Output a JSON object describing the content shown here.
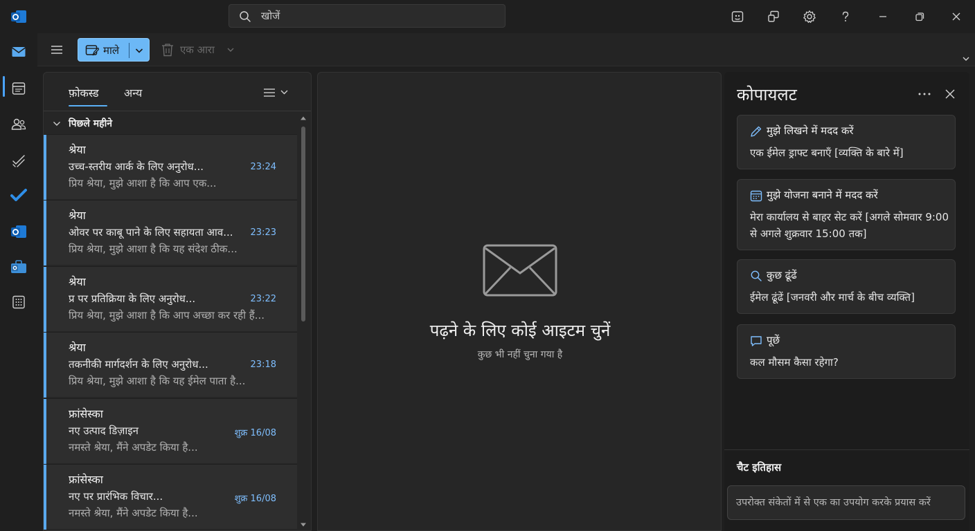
{
  "app": {
    "search_placeholder": "खोजें"
  },
  "toolbar": {
    "new_mail_label": "माले",
    "delete_label": "एक आरा"
  },
  "list": {
    "tabs": [
      {
        "label": "फ़ोकस्ड",
        "active": true
      },
      {
        "label": "अन्य",
        "active": false
      }
    ],
    "group_label": "पिछले महीने",
    "messages": [
      {
        "sender": "श्रेया",
        "subject": "उच्च-स्तरीय आर्क के लिए अनुरोध...",
        "time": "23:24",
        "preview": "प्रिय श्रेया, मुझे आशा है कि आप एक..."
      },
      {
        "sender": "श्रेया",
        "subject": "ओवर पर काबू पाने के लिए सहायता आव...",
        "time": "23:23",
        "preview": "प्रिय श्रेया, मुझे आशा है कि यह संदेश ठीक..."
      },
      {
        "sender": "श्रेया",
        "subject": "प्र पर प्रतिक्रिया के लिए अनुरोध...",
        "time": "23:22",
        "preview": "प्रिय श्रेया, मुझे आशा है कि आप अच्छा कर रही हैं..."
      },
      {
        "sender": "श्रेया",
        "subject": "तकनीकी मार्गदर्शन के लिए अनुरोध...",
        "time": "23:18",
        "preview": "प्रिय श्रेया, मुझे आशा है कि यह ईमेल पाता है..."
      },
      {
        "sender": "फ्रांसेस्का",
        "subject": "नए उत्पाद डिज़ाइन",
        "time": "शुक्र 16/08",
        "preview": "नमस्ते श्रेया, मैंने अपडेट किया है..."
      },
      {
        "sender": "फ्रांसेस्का",
        "subject": "नए पर प्रारंभिक विचार...",
        "time": "शुक्र 16/08",
        "preview": "नमस्ते श्रेया, मैंने अपडेट किया है..."
      }
    ]
  },
  "reading": {
    "empty_title": "पढ़ने के लिए कोई आइटम चुनें",
    "empty_subtitle": "कुछ भी नहीं चुना गया है"
  },
  "copilot": {
    "title": "कोपायलट",
    "cards": [
      {
        "icon": "pencil-icon",
        "head": "मुझे लिखने में मदद करें",
        "body": "एक ईमेल ड्राफ्ट बनाएँ [व्यक्ति के बारे में]"
      },
      {
        "icon": "calendar-icon",
        "head": "मुझे योजना बनाने में मदद करें",
        "body": "मेरा कार्यालय से बाहर सेट करें [अगले सोमवार 9:00 से अगले शुक्रवार 15:00 तक]"
      },
      {
        "icon": "search-icon",
        "head": "कुछ ढूंढें",
        "body": "ईमेल ढूंढें [जनवरी और मार्च के बीच व्यक्ति]"
      },
      {
        "icon": "chat-icon",
        "head": "पूछें",
        "body": "कल मौसम कैसा रहेगा?"
      }
    ],
    "history_label": "चैट इतिहास",
    "input_placeholder": "उपरोक्त संकेतों में से एक का उपयोग करके प्रयास करें"
  },
  "colors": {
    "accent": "#5aa9ee",
    "primary_button": "#6cb8f6",
    "background": "#1f1f1f"
  }
}
